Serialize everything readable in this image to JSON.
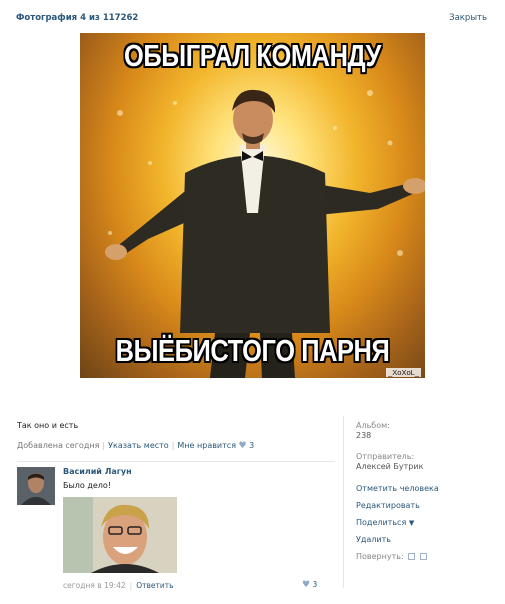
{
  "header": {
    "title": "Фотография 4 из 117262",
    "close_label": "Закрыть"
  },
  "photo": {
    "top_caption": "ОБЫГРАЛ КОМАНДУ",
    "bottom_caption": "ВЫЁБИСТОГО ПАРНЯ",
    "watermark": "_XoXoL_"
  },
  "post": {
    "description": "Так оно и есть",
    "added": "Добавлена сегодня",
    "place_link": "Указать место",
    "like_label": "Мне нравится",
    "like_count": "3"
  },
  "comment": {
    "author": "Василий Лагун",
    "text": "Было дело!",
    "time": "сегодня в 19:42",
    "reply_label": "Ответить",
    "like_count": "3"
  },
  "sidebar": {
    "album_label": "Альбом:",
    "album_value": "238",
    "sender_label": "Отправитель:",
    "sender_value": "Алексей Бутрик",
    "actions": {
      "tag": "Отметить человека",
      "edit": "Редактировать",
      "share": "Поделиться",
      "delete": "Удалить",
      "rotate": "Повернуть:"
    }
  },
  "colors": {
    "link": "#2b587a",
    "meta": "#777777",
    "divider": "#e3e8ee"
  }
}
